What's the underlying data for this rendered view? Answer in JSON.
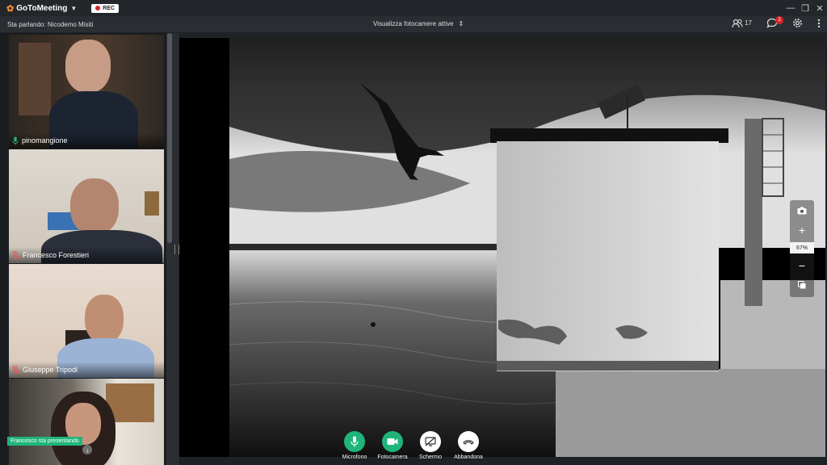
{
  "app": {
    "name": "GoToMeeting",
    "rec_label": "REC"
  },
  "infobar": {
    "speaking": "Sta parlando: Nicodemo Misiti",
    "camera_view": "Visualizza fotocamere attive",
    "participants_count": "17",
    "chat_badge": "2"
  },
  "participants": [
    {
      "name": "pinomangione",
      "mic": "on"
    },
    {
      "name": "Francesco Forestieri",
      "mic": "muted"
    },
    {
      "name": "Giuseppe Tripodi",
      "mic": "muted"
    },
    {
      "name": "",
      "mic": "none"
    }
  ],
  "presenting": "Francesco sta presentando",
  "zoom": {
    "value": "67%"
  },
  "controls": {
    "mic": "Microfono",
    "camera": "Fotocamera",
    "screen": "Schermo",
    "leave": "Abbandona"
  },
  "colors": {
    "accent_green": "#1fb57a",
    "rec_red": "#d7262a",
    "brand_orange": "#f68d2e"
  }
}
